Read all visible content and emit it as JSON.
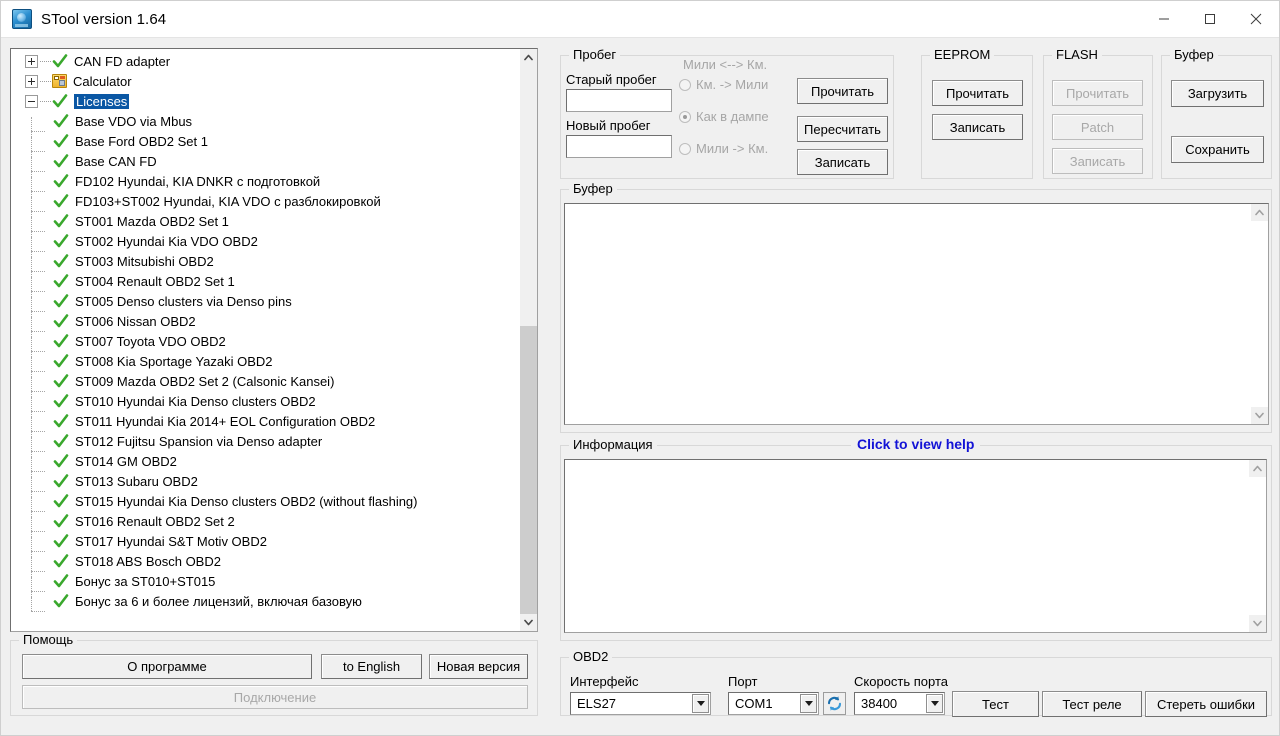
{
  "window": {
    "title": "STool version 1.64",
    "icon": "app-icon",
    "controls": {
      "minimize": "minimize-icon",
      "maximize": "maximize-icon",
      "close": "close-icon"
    }
  },
  "tree": {
    "roots": [
      {
        "label": "CAN FD adapter",
        "expander": "plus",
        "icon": "green-check-icon"
      },
      {
        "label": "Calculator",
        "expander": "plus",
        "icon": "calculator-icon"
      },
      {
        "label": "Licenses",
        "expander": "minus",
        "icon": "green-check-icon",
        "selected": true
      }
    ],
    "children": [
      "Base VDO via Mbus",
      "Base Ford OBD2 Set 1",
      "Base CAN FD",
      "FD102 Hyundai, KIA DNKR с подготовкой",
      "FD103+ST002 Hyundai, KIA VDO с разблокировкой",
      "ST001 Mazda OBD2 Set 1",
      "ST002 Hyundai Kia VDO OBD2",
      "ST003 Mitsubishi OBD2",
      "ST004 Renault OBD2 Set 1",
      "ST005 Denso clusters via Denso pins",
      "ST006 Nissan OBD2",
      "ST007 Toyota VDO OBD2",
      "ST008 Kia Sportage Yazaki OBD2",
      "ST009 Mazda OBD2 Set 2 (Calsonic Kansei)",
      "ST010 Hyundai Kia Denso clusters OBD2",
      "ST011 Hyundai Kia 2014+ EOL Configuration OBD2",
      "ST012 Fujitsu Spansion via Denso adapter",
      "ST014 GM OBD2",
      "ST013 Subaru OBD2",
      "ST015 Hyundai Kia Denso clusters OBD2 (without flashing)",
      "ST016 Renault OBD2 Set 2",
      "ST017 Hyundai S&T Motiv OBD2",
      "ST018 ABS Bosch OBD2",
      "Бонус за ST010+ST015",
      "Бонус за 6 и более лицензий, включая базовую"
    ]
  },
  "help": {
    "legend": "Помощь",
    "about_label": "О программе",
    "english_label": "to English",
    "new_version_label": "Новая версия",
    "connect_label": "Подключение",
    "connect_disabled": true
  },
  "mileage": {
    "legend": "Пробег",
    "old_label": "Старый пробег",
    "old_value": "",
    "new_label": "Новый пробег",
    "new_value": "",
    "conv_title": "Мили <--> Км.",
    "radios": [
      {
        "label": "Км. -> Мили",
        "checked": false
      },
      {
        "label": "Как в дампе",
        "checked": true
      },
      {
        "label": "Мили -> Км.",
        "checked": false
      }
    ],
    "read_label": "Прочитать",
    "recalc_label": "Пересчитать",
    "write_label": "Записать"
  },
  "eeprom": {
    "legend": "EEPROM",
    "read_label": "Прочитать",
    "write_label": "Записать"
  },
  "flash": {
    "legend": "FLASH",
    "read_label": "Прочитать",
    "patch_label": "Patch",
    "write_label": "Записать",
    "disabled": true
  },
  "buffer_actions": {
    "legend": "Буфер",
    "load_label": "Загрузить",
    "save_label": "Сохранить"
  },
  "buffer_panel": {
    "legend": "Буфер",
    "content": ""
  },
  "info_panel": {
    "legend": "Информация",
    "help_link": "Click to view help",
    "help_link_color": "#1313d6",
    "content": ""
  },
  "obd2": {
    "legend": "OBD2",
    "interface_label": "Интерфейс",
    "interface_value": "ELS27",
    "port_label": "Порт",
    "port_value": "COM1",
    "refresh_icon": "refresh-icon",
    "speed_label": "Скорость порта",
    "speed_value": "38400",
    "test_label": "Тест",
    "test_relay_label": "Тест реле",
    "clear_errors_label": "Стереть ошибки"
  },
  "colors": {
    "selection": "#0a57a4",
    "check": "#3aa82d",
    "link": "#1313d6",
    "window_bg": "#f0f0f0"
  }
}
